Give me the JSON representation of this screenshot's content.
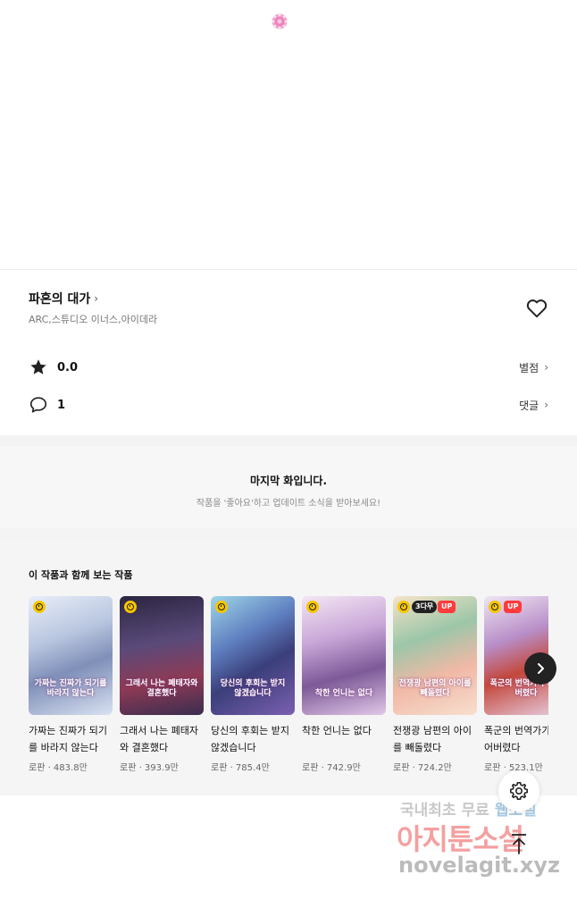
{
  "colors": {
    "accent_yellow": "#f7c600",
    "up_red": "#ff3b3b",
    "gray_background": "#f5f5f5"
  },
  "top": {
    "icon": "flower-icon"
  },
  "series": {
    "title": "파혼의 대가",
    "authors": "ARC,스튜디오 이너스,아이데라",
    "favorite_icon": "heart-outline-icon"
  },
  "stats": {
    "rating_icon": "star-icon",
    "rating_value": "0.0",
    "rating_link": "별점",
    "comment_icon": "speech-bubble-icon",
    "comment_count": "1",
    "comment_link": "댓글"
  },
  "last_episode": {
    "title": "마지막 화입니다.",
    "subtitle": "작품을 '좋아요'하고 업데이트 소식을 받아보세요!"
  },
  "recommendations": {
    "heading": "이 작품과 함께 보는 작품",
    "items": [
      {
        "title": "가짜는 진짜가 되기를 바라지 않는다",
        "meta": "로판 · 483.8만",
        "cover_text": "가짜는 진짜가 되기를 바라지 않는다",
        "free_badge": "",
        "up_badge": ""
      },
      {
        "title": "그래서 나는 폐태자와 결혼했다",
        "meta": "로판 · 393.9만",
        "cover_text": "그래서 나는 폐태자와 결혼했다",
        "free_badge": "",
        "up_badge": ""
      },
      {
        "title": "당신의 후회는 받지 않겠습니다",
        "meta": "로판 · 785.4만",
        "cover_text": "당신의 후회는 받지 않겠습니다",
        "free_badge": "",
        "up_badge": ""
      },
      {
        "title": "착한 언니는 없다",
        "meta": "로판 · 742.9만",
        "cover_text": "착한 언니는 없다",
        "free_badge": "",
        "up_badge": ""
      },
      {
        "title": "전쟁광 남편의 아이를 빼돌렸다",
        "meta": "로판 · 724.2만",
        "cover_text": "전쟁광 남편의 아이를 빼돌렸다",
        "free_badge": "3다무",
        "up_badge": "UP"
      },
      {
        "title": "폭군의 번역가가 되어버렸다",
        "meta": "로판 · 523.1만",
        "cover_text": "폭군의 번역가가 되어버렸다",
        "free_badge": "",
        "up_badge": "UP"
      }
    ]
  },
  "floating": {
    "settings_icon": "gear-icon",
    "totop_icon": "arrow-up-icon"
  },
  "watermark": {
    "line1": "국내최초 무료",
    "line1_accent": "웹소설",
    "line2": "아지툰소설",
    "line3": "novelagit.xyz"
  }
}
